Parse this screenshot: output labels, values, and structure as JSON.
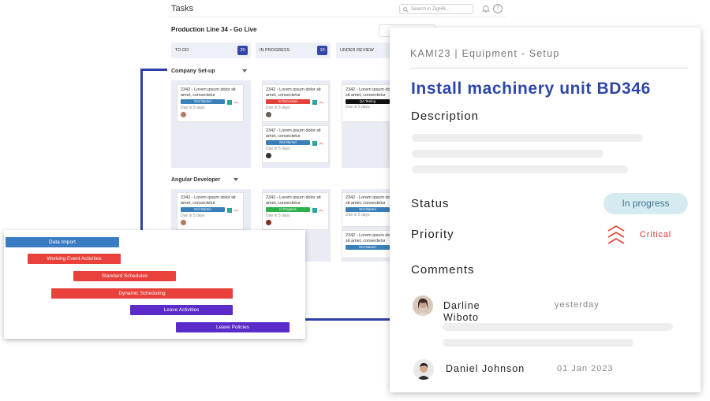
{
  "board": {
    "title": "Tasks",
    "search_placeholder": "Search in ZigHR...",
    "project_title": "Production Line 34 - Go Live",
    "columns": [
      {
        "label": "TO DO",
        "count": "20"
      },
      {
        "label": "IN PROGRESS",
        "count": "10"
      },
      {
        "label": "UNDER REVIEW",
        "count": ""
      }
    ],
    "groups": [
      {
        "label": "Company Set-up"
      },
      {
        "label": "Angular Developer"
      }
    ],
    "cards": [
      {
        "desc": "2342 - Lorem ipsum dolor sit amet, consectetur",
        "status": "Not Started",
        "due": "Due in 5 days"
      },
      {
        "desc": "2342 - Lorem ipsum dolor sit amet, consectetur",
        "status": "In Discussion",
        "due": "Due in 5 days"
      },
      {
        "desc": "2342 - Lorem ipsum dolor sit amet, consectetur",
        "status": "QA Testing",
        "due": "Due in 5 days"
      },
      {
        "desc": "2342 - Lorem ipsum dolor sit amet, consectetur",
        "status": "Not Started",
        "due": "Due in 5 days"
      },
      {
        "desc": "2342 - Lorem ipsum dolor sit amet, consectetur",
        "status": "Not Started",
        "due": "Due in 5 days"
      },
      {
        "desc": "2342 - Lorem ipsum dolor sit amet, consectetur",
        "status": "In Progress",
        "due": "Due in 5 days"
      },
      {
        "desc": "2342 - Lorem ipsum dolor sit amet, consectetur",
        "status": "Not Started",
        "due": "Due in 5 days"
      },
      {
        "desc": "2342 - Lorem ipsum dolor sit amet, consectetur",
        "status": "Not Started",
        "due": ""
      }
    ]
  },
  "gantt": {
    "tasks": [
      {
        "label": "Data Import",
        "color": "#3a7cc4"
      },
      {
        "label": "Working Event Activities",
        "color": "#e8403a"
      },
      {
        "label": "Standard Schedules",
        "color": "#e8403a"
      },
      {
        "label": "Dynamic Scheduling",
        "color": "#e8403a"
      },
      {
        "label": "Leave Activities",
        "color": "#5b2bc9"
      },
      {
        "label": "Leave Policies",
        "color": "#5b2bc9"
      }
    ]
  },
  "detail": {
    "breadcrumb": "KAMI23 | Equipment - Setup",
    "title": "Install machinery unit BD346",
    "description_label": "Description",
    "status_label": "Status",
    "status_value": "In progress",
    "priority_label": "Priority",
    "priority_value": "Critical",
    "comments_label": "Comments",
    "comments": [
      {
        "name": "Darline\nWiboto",
        "time": "yesterday"
      },
      {
        "name": "Daniel Johnson",
        "time": "01 Jan 2023"
      }
    ]
  },
  "colors": {
    "accent": "#2d47a9",
    "critical": "#dd3333",
    "status_pill": "#d6ebf1"
  }
}
